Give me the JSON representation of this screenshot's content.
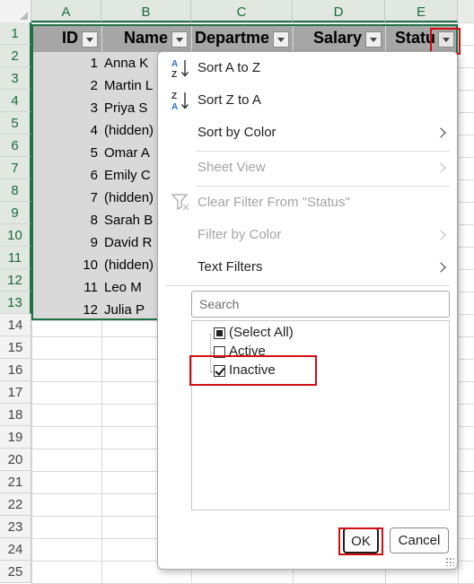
{
  "columns": [
    "A",
    "B",
    "C",
    "D",
    "E"
  ],
  "rows": [
    "1",
    "2",
    "3",
    "4",
    "5",
    "6",
    "7",
    "8",
    "9",
    "10",
    "11",
    "12",
    "13",
    "14",
    "15",
    "16",
    "17",
    "18",
    "19",
    "20",
    "21",
    "22",
    "23",
    "24",
    "25"
  ],
  "headers": {
    "id": "ID",
    "name": "Name",
    "department": "Departme",
    "salary": "Salary",
    "status": "Statu"
  },
  "data_rows": [
    {
      "id": "1",
      "name": "Anna K"
    },
    {
      "id": "2",
      "name": "Martin L"
    },
    {
      "id": "3",
      "name": "Priya S"
    },
    {
      "id": "4",
      "name": "(hidden)"
    },
    {
      "id": "5",
      "name": "Omar A"
    },
    {
      "id": "6",
      "name": "Emily C"
    },
    {
      "id": "7",
      "name": "(hidden)"
    },
    {
      "id": "8",
      "name": "Sarah B"
    },
    {
      "id": "9",
      "name": "David R"
    },
    {
      "id": "10",
      "name": "(hidden)"
    },
    {
      "id": "11",
      "name": "Leo M"
    },
    {
      "id": "12",
      "name": "Julia P"
    }
  ],
  "menu": {
    "sort_a_z": "Sort A to Z",
    "sort_z_a": "Sort Z to A",
    "sort_by_color": "Sort by Color",
    "sheet_view": "Sheet View",
    "clear_filter": "Clear Filter From \"Status\"",
    "filter_by_color": "Filter by Color",
    "text_filters": "Text Filters",
    "search_placeholder": "Search",
    "items": [
      {
        "label": "(Select All)",
        "state": "partial"
      },
      {
        "label": "Active",
        "state": "unchecked"
      },
      {
        "label": "Inactive",
        "state": "checked"
      }
    ],
    "ok": "OK",
    "cancel": "Cancel"
  },
  "colors": {
    "selection_green": "#1e7145",
    "header_fill": "#a6a6a6",
    "data_fill": "#d9d9d9",
    "highlight_red": "#d01010"
  }
}
